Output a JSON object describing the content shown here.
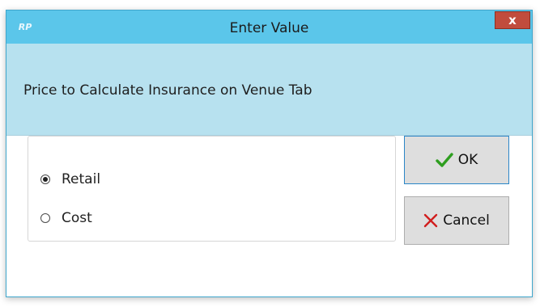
{
  "window": {
    "title": "Enter Value",
    "app_icon_text": "RP",
    "close_label": "x"
  },
  "prompt": "Price to Calculate Insurance on Venue Tab",
  "options": [
    {
      "label": "Retail",
      "selected": true
    },
    {
      "label": "Cost",
      "selected": false
    }
  ],
  "buttons": {
    "ok_label": "OK",
    "cancel_label": "Cancel"
  },
  "colors": {
    "titlebar": "#5bc6ea",
    "header_band": "#b7e1ef",
    "close": "#c14c3d",
    "ok_check": "#2e9e1f",
    "cancel_x": "#d11e1e"
  },
  "icons": {
    "app": "app-logo-icon",
    "close": "close-icon",
    "ok": "checkmark-icon",
    "cancel": "cross-icon"
  }
}
